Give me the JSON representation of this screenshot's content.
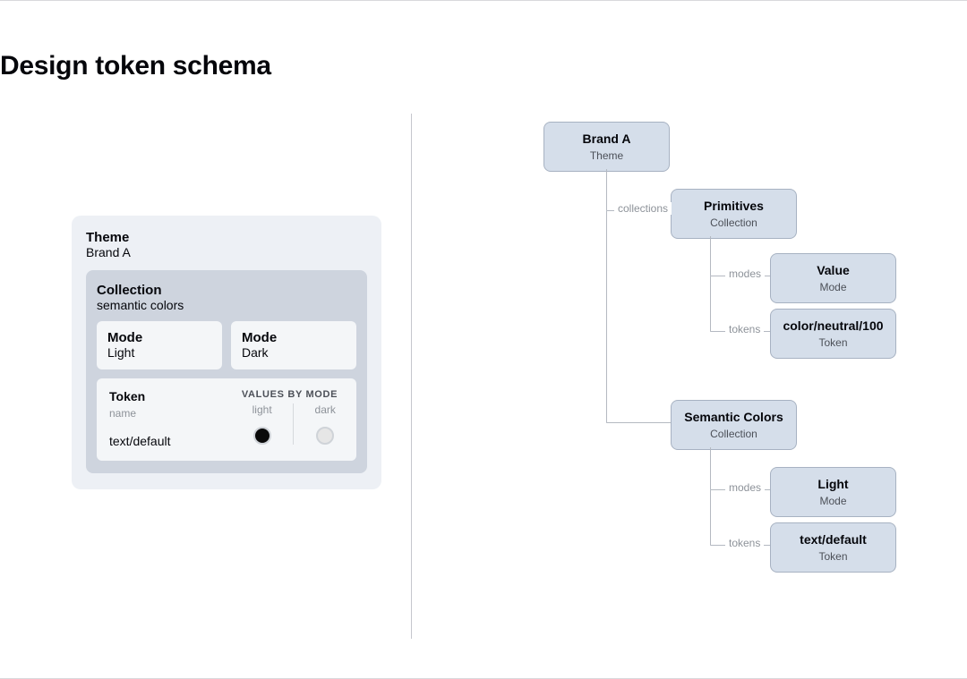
{
  "title": "Design token schema",
  "left": {
    "theme_label": "Theme",
    "theme_name": "Brand A",
    "collection_label": "Collection",
    "collection_name": "semantic colors",
    "mode_label": "Mode",
    "modes": {
      "light": "Light",
      "dark": "Dark"
    },
    "token_label": "Token",
    "token_sub": "name",
    "token_name": "text/default",
    "values_header": "VALUES BY MODE",
    "value_cols": {
      "light": "light",
      "dark": "dark"
    }
  },
  "tree": {
    "brandA": {
      "title": "Brand A",
      "sub": "Theme"
    },
    "edge_collections": "collections",
    "primitives": {
      "title": "Primitives",
      "sub": "Collection"
    },
    "edge_modes": "modes",
    "value_mode": {
      "title": "Value",
      "sub": "Mode"
    },
    "edge_tokens": "tokens",
    "prim_token": {
      "title": "color/neutral/100",
      "sub": "Token"
    },
    "semantic": {
      "title": "Semantic Colors",
      "sub": "Collection"
    },
    "light_mode": {
      "title": "Light",
      "sub": "Mode"
    },
    "sem_token": {
      "title": "text/default",
      "sub": "Token"
    }
  }
}
